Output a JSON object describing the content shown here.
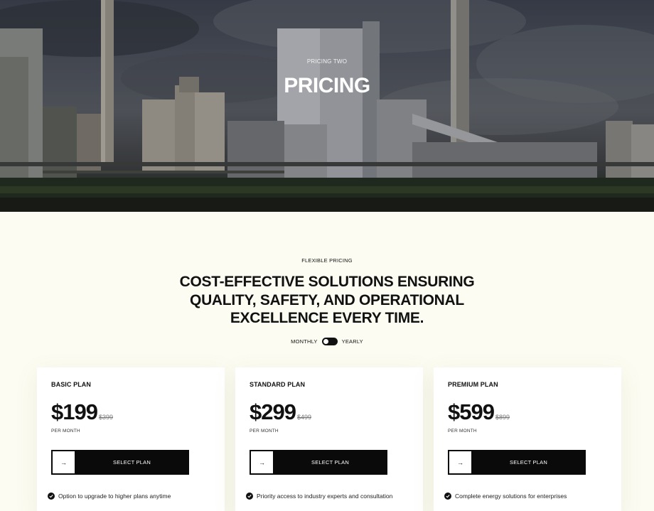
{
  "hero": {
    "eyebrow": "PRICING TWO",
    "title": "PRICING"
  },
  "intro": {
    "eyebrow": "FLEXIBLE PRICING",
    "heading": "COST-EFFECTIVE SOLUTIONS ENSURING QUALITY, SAFETY, AND OPERATIONAL EXCELLENCE EVERY TIME."
  },
  "billing": {
    "monthly_label": "MONTHLY",
    "yearly_label": "YEARLY",
    "selected": "yearly"
  },
  "plans": [
    {
      "name": "BASIC PLAN",
      "price": "$199",
      "old_price": "$399",
      "period": "PER MONTH",
      "button_label": "SELECT PLAN",
      "button_icon": "→",
      "feature": "Option to upgrade to higher plans anytime"
    },
    {
      "name": "STANDARD PLAN",
      "price": "$299",
      "old_price": "$499",
      "period": "PER MONTH",
      "button_label": "SELECT PLAN",
      "button_icon": "→",
      "feature": "Priority access to industry experts and consultation"
    },
    {
      "name": "PREMIUM PLAN",
      "price": "$599",
      "old_price": "$899",
      "period": "PER MONTH",
      "button_label": "SELECT PLAN",
      "button_icon": "→",
      "feature": "Complete energy solutions for enterprises"
    }
  ],
  "colors": {
    "page_background": "#fcfcf2",
    "button_background": "#0a0a0a",
    "text": "#111111"
  }
}
